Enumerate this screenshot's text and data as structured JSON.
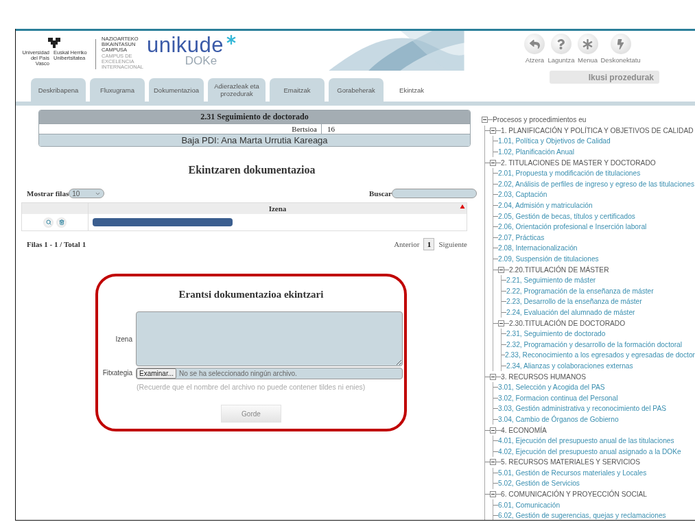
{
  "header": {
    "university_es": "Universidad del País Vasco",
    "university_eu": "Euskal Herriko Unibertsitatea",
    "campus_eu": "NAZIOARTEKO BIKAINTASUN CAMPUSA",
    "campus_es": "CAMPUS DE EXCELENCIA INTERNACIONAL",
    "brand": "unikude",
    "brand_sub": "DOKe"
  },
  "toolbar": {
    "actions": [
      {
        "label": "Atzera",
        "kind": "back"
      },
      {
        "label": "Laguntza",
        "kind": "help"
      },
      {
        "label": "Menua",
        "kind": "menu"
      },
      {
        "label": "Deskonektatu",
        "kind": "disconnect"
      }
    ],
    "procedures_button": {
      "label": "Ikusi prozedurak",
      "disabled": true
    }
  },
  "tabs": [
    {
      "label": "Deskribapena",
      "selected": false
    },
    {
      "label": "Fluxugrama",
      "selected": false
    },
    {
      "label": "Dokumentazioa",
      "selected": false
    },
    {
      "label": "Adierazleak eta prozedurak",
      "selected": false
    },
    {
      "label": "Emaitzak",
      "selected": false
    },
    {
      "label": "Gorabeherak",
      "selected": false
    },
    {
      "label": "Ekintzak",
      "selected": true
    }
  ],
  "process": {
    "title": "2.31 Seguimiento de doctorado",
    "version_label": "Bertsioa",
    "version": "16",
    "subtitle": "Baja PDI: Ana Marta Urrutia Kareaga"
  },
  "documentation": {
    "title": "Ekintzaren dokumentazioa",
    "rows_label": "Mostrar filas",
    "rows_value": "10",
    "search_label": "Buscar",
    "columns": [
      {
        "label": "Izena",
        "sorted": true
      }
    ],
    "rows": [
      {
        "redacted": true
      }
    ],
    "summary": "Filas 1 - 1 / Total 1",
    "pagination": {
      "previous": "Anterior",
      "pages": [
        {
          "label": "1",
          "selected": true
        }
      ],
      "next": "Siguiente"
    }
  },
  "upload_form": {
    "title": "Erantsi dokumentazioa ekintzari",
    "highlighted": true,
    "name_label": "Izena",
    "file_label": "Fitxategia",
    "browse_button": "Examinar...",
    "file_status": "No se ha seleccionado ningún archivo.",
    "hint": "(Recuerde que el nombre del archivo no puede contener tildes ni enies)",
    "submit": "Gorde"
  },
  "tree": {
    "label": "Procesos y procedimientos eu",
    "expanded": true,
    "children": [
      {
        "label": "1. PLANIFICACIÓN Y POLÍTICA Y OBJETIVOS DE CALIDAD",
        "expanded": true,
        "children": [
          {
            "label": "1.01, Política y Objetivos de Calidad"
          },
          {
            "label": "1.02, Planificación Anual"
          }
        ]
      },
      {
        "label": "2. TITULACIONES DE MASTER Y DOCTORADO",
        "expanded": true,
        "children": [
          {
            "label": "2.01, Propuesta y modificación de titulaciones"
          },
          {
            "label": "2.02, Análisis de perfiles de ingreso y egreso de las titulaciones"
          },
          {
            "label": "2.03, Captación"
          },
          {
            "label": "2.04, Admisión y matriculación"
          },
          {
            "label": "2.05, Gestión de becas, títulos y certificados"
          },
          {
            "label": "2.06, Orientación profesional e Inserción laboral"
          },
          {
            "label": "2.07, Prácticas"
          },
          {
            "label": "2.08, Internacionalización"
          },
          {
            "label": "2.09, Suspensión de titulaciones"
          },
          {
            "label": "2.20.TITULACIÓN DE MÁSTER",
            "expanded": true,
            "children": [
              {
                "label": "2.21, Seguimiento de máster"
              },
              {
                "label": "2.22, Programación de la enseñanza de máster"
              },
              {
                "label": "2.23, Desarrollo de la enseñanza de máster"
              },
              {
                "label": "2.24, Evaluación del alumnado de máster"
              }
            ]
          },
          {
            "label": "2.30.TITULACIÓN DE DOCTORADO",
            "expanded": true,
            "children": [
              {
                "label": "2.31, Seguimiento de doctorado"
              },
              {
                "label": "2.32, Programación y desarrollo de la formación doctoral"
              },
              {
                "label": "2.33, Reconocimiento a los egresados y egresadas de doctor"
              },
              {
                "label": "2.34, Alianzas y colaboraciones externas"
              }
            ]
          }
        ]
      },
      {
        "label": "3. RECURSOS HUMANOS",
        "expanded": true,
        "children": [
          {
            "label": "3.01, Selección y Acogida del PAS"
          },
          {
            "label": "3.02, Formacion continua del Personal"
          },
          {
            "label": "3.03, Gestión administrativa y reconocimiento del PAS"
          },
          {
            "label": "3.04, Cambio de Órganos de Gobierno"
          }
        ]
      },
      {
        "label": "4. ECONOMÍA",
        "expanded": true,
        "children": [
          {
            "label": "4.01, Ejecución del presupuesto anual de las titulaciones"
          },
          {
            "label": "4.02, Ejecución del presupuesto anual asignado a la DOKe"
          }
        ]
      },
      {
        "label": "5. RECURSOS MATERIALES Y SERVICIOS",
        "expanded": true,
        "children": [
          {
            "label": "5.01, Gestión de Recursos materiales y Locales"
          },
          {
            "label": "5.02, Gestión de Servicios"
          }
        ]
      },
      {
        "label": "6. COMUNICACIÓN Y PROYECCIÓN SOCIAL",
        "expanded": true,
        "children": [
          {
            "label": "6.01, Comunicación"
          },
          {
            "label": "6.02, Gestión de sugerencias, quejas y reclamaciones"
          }
        ]
      }
    ]
  }
}
